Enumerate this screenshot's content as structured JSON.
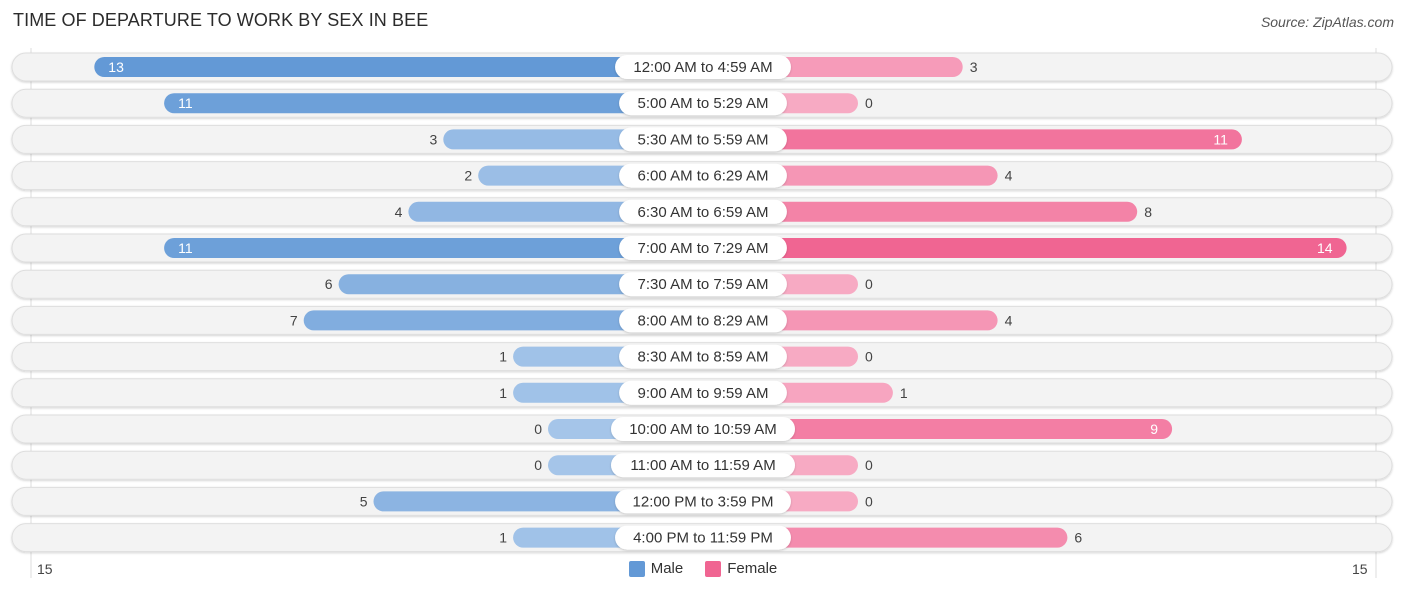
{
  "header": {
    "title": "TIME OF DEPARTURE TO WORK BY SEX IN BEE",
    "source": "Source: ZipAtlas.com"
  },
  "colors": {
    "male_dark": "#6399d6",
    "male_light": "#a5c5e9",
    "female_dark": "#f06592",
    "female_light": "#f7aac3",
    "track": "#f3f3f3"
  },
  "chart_data": {
    "type": "bar",
    "orientation": "horizontal-diverging",
    "title": "TIME OF DEPARTURE TO WORK BY SEX IN BEE",
    "categories": [
      "12:00 AM to 4:59 AM",
      "5:00 AM to 5:29 AM",
      "5:30 AM to 5:59 AM",
      "6:00 AM to 6:29 AM",
      "6:30 AM to 6:59 AM",
      "7:00 AM to 7:29 AM",
      "7:30 AM to 7:59 AM",
      "8:00 AM to 8:29 AM",
      "8:30 AM to 8:59 AM",
      "9:00 AM to 9:59 AM",
      "10:00 AM to 10:59 AM",
      "11:00 AM to 11:59 AM",
      "12:00 PM to 3:59 PM",
      "4:00 PM to 11:59 PM"
    ],
    "series": [
      {
        "name": "Male",
        "values": [
          13,
          11,
          3,
          2,
          4,
          11,
          6,
          7,
          1,
          1,
          0,
          0,
          5,
          1
        ]
      },
      {
        "name": "Female",
        "values": [
          3,
          0,
          11,
          4,
          8,
          14,
          0,
          4,
          0,
          1,
          9,
          0,
          0,
          6
        ]
      }
    ],
    "xlim": [
      15,
      15
    ],
    "axis_labels": {
      "left": "15",
      "right": "15"
    },
    "legend": {
      "position": "bottom-center",
      "entries": [
        "Male",
        "Female"
      ]
    },
    "grid": false
  }
}
